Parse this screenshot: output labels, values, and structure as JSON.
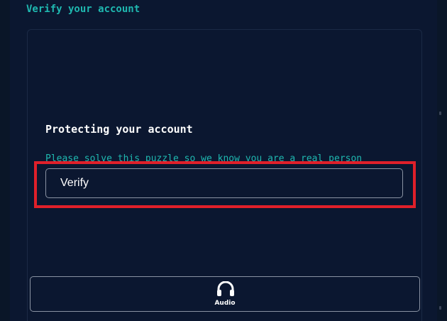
{
  "header": {
    "title": "Verify your account"
  },
  "card": {
    "heading": "Protecting your account",
    "subtext": "Please solve this puzzle so we know you are a real person",
    "verify_label": "Verify"
  },
  "audio": {
    "label": "Audio",
    "icon": "headphones-icon"
  },
  "colors": {
    "background": "#0a1628",
    "accent": "#1fb8b0",
    "highlight": "#e0202a",
    "text": "#ffffff"
  }
}
